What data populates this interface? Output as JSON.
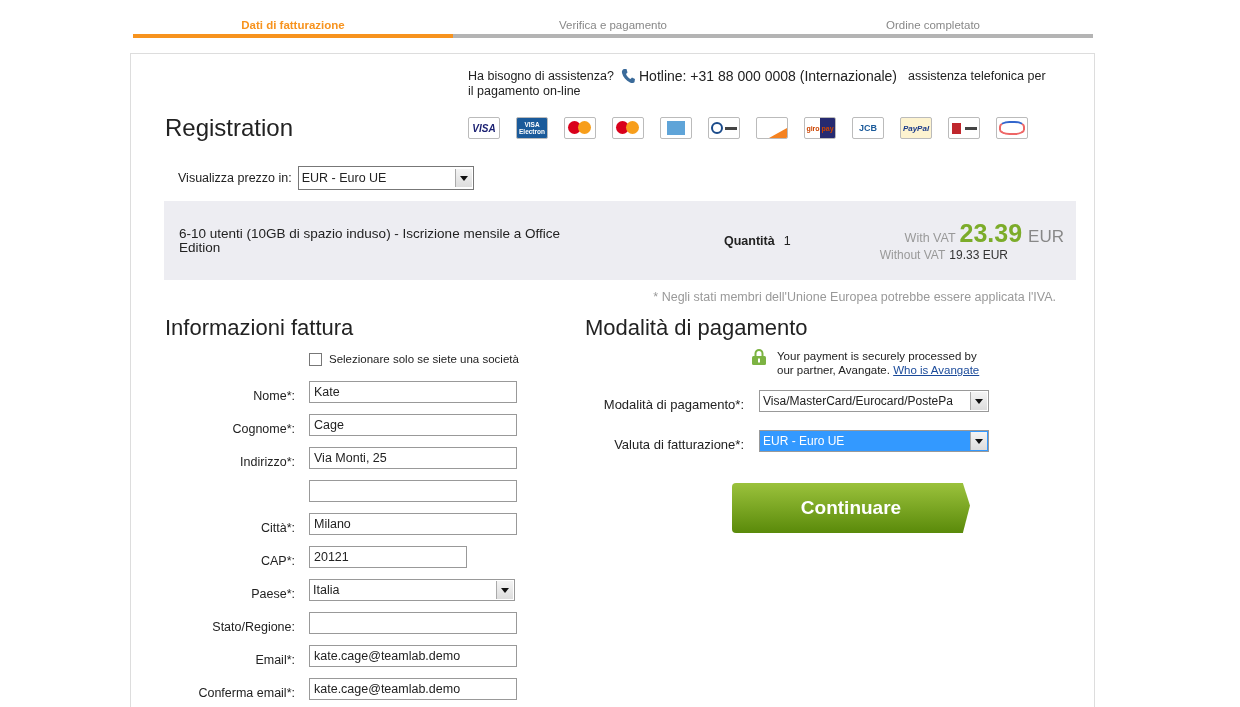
{
  "steps": [
    {
      "label": "Dati di fatturazione",
      "selected": true
    },
    {
      "label": "Verifica e pagamento",
      "selected": false
    },
    {
      "label": "Ordine completato",
      "selected": false
    }
  ],
  "help": {
    "question": "Ha bisogno di assistenza?",
    "hotline": "Hotline: +31 88 000 0008 (Internazionale)",
    "note": "assistenza telefonica per",
    "note_cont": "il pagamento on-line"
  },
  "title": "Registration",
  "payment_logos": [
    {
      "kind": "text",
      "label": "VISA"
    },
    {
      "kind": "electron",
      "label": "VISA Electron"
    },
    {
      "kind": "circles"
    },
    {
      "kind": "circles"
    },
    {
      "kind": "amex"
    },
    {
      "kind": "diners"
    },
    {
      "kind": "discover"
    },
    {
      "kind": "giro",
      "label": "giro pay"
    },
    {
      "kind": "jcb",
      "label": "JCB"
    },
    {
      "kind": "paypal",
      "label": "PayPal"
    },
    {
      "kind": "wire"
    },
    {
      "kind": "other"
    }
  ],
  "price_currency": {
    "label": "Visualizza prezzo in:",
    "value": "EUR - Euro UE"
  },
  "product": {
    "name": "6-10 utenti (10GB di spazio induso) - Iscrizione mensile a Office Edition",
    "quantity_label": "Quantità",
    "quantity": "1",
    "with_vat_label": "With VAT",
    "price": "23.39",
    "currency": "EUR",
    "without_vat_label": "Without VAT",
    "price_without_vat": "19.33 EUR"
  },
  "footnote": "* Negli stati membri dell'Unione Europea potrebbe essere applicata l'IVA.",
  "billing": {
    "title": "Informazioni fattura",
    "fields": [
      {
        "kind": "checkbox",
        "label": "Selezionare solo se siete una società",
        "checked": false
      },
      {
        "kind": "text",
        "label": "Nome*:",
        "value": "Kate"
      },
      {
        "kind": "text",
        "label": "Cognome*:",
        "value": "Cage"
      },
      {
        "kind": "text",
        "label": "Indirizzo*:",
        "value": "Via Monti, 25"
      },
      {
        "kind": "text"
      },
      {
        "kind": "text",
        "label": "Città*:",
        "value": "Milano"
      },
      {
        "kind": "short",
        "label": "CAP*:",
        "value": "20121"
      },
      {
        "kind": "select",
        "label": "Paese*:",
        "value": "Italia"
      },
      {
        "kind": "text",
        "label": "Stato/Regione:"
      },
      {
        "kind": "text",
        "label": "Email*:",
        "value": "kate.cage@teamlab.demo"
      },
      {
        "kind": "text",
        "label": "Conferma email*:",
        "value": "kate.cage@teamlab.demo"
      }
    ]
  },
  "payment": {
    "title": "Modalità di pagamento",
    "secure_text": "Your payment is securely processed by our partner, Avangate.",
    "secure_link": "Who is Avangate",
    "fields": [
      {
        "label": "Modalità di pagamento*:",
        "value": "Visa/MasterCard/Eurocard/PostePa",
        "highlighted": false
      },
      {
        "label": "Valuta di fatturazione*:",
        "value": "EUR - Euro UE",
        "highlighted": true
      }
    ],
    "button": "Continuare"
  }
}
